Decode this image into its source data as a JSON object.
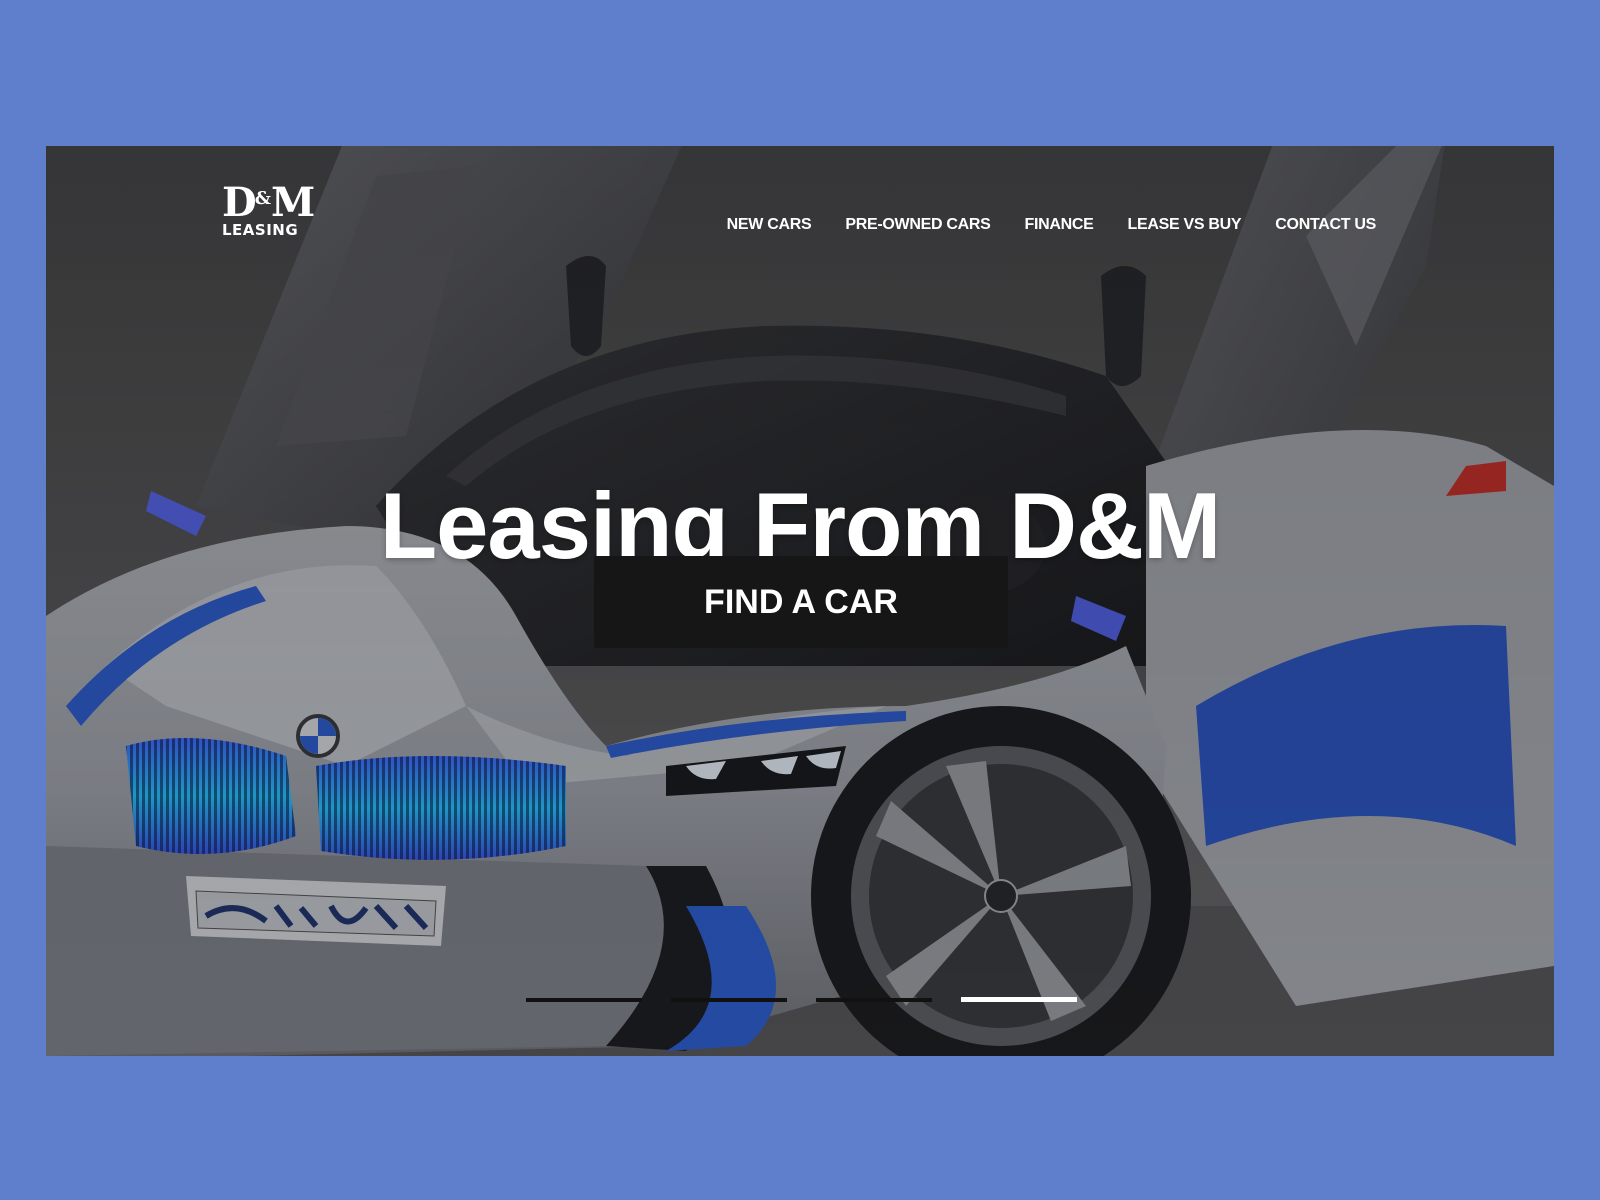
{
  "brand": {
    "logo_mark_left": "D",
    "logo_mark_amp": "&",
    "logo_mark_right": "M",
    "logo_sub": "LEASING"
  },
  "nav": {
    "items": [
      {
        "label": "NEW CARS"
      },
      {
        "label": "PRE-OWNED CARS"
      },
      {
        "label": "FINANCE"
      },
      {
        "label": "LEASE VS BUY"
      },
      {
        "label": "CONTACT US"
      }
    ]
  },
  "hero": {
    "headline": "Leasing From D&M",
    "cta_label": "FIND A CAR",
    "image": "concept-sports-car-photo",
    "slides_total": 4,
    "active_slide": 4
  },
  "colors": {
    "page_background": "#5f7ecb",
    "cta_background": "#161616",
    "text": "#ffffff",
    "car_accent": "#2f5fd0"
  }
}
